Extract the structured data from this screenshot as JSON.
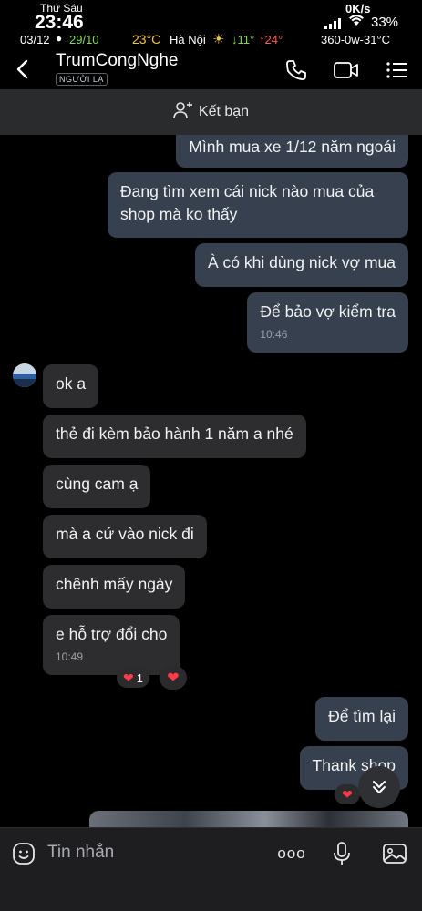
{
  "status_bar": {
    "day": "Thứ Sáu",
    "time": "23:46",
    "date": "03/12",
    "lunar_date": "29/10",
    "temperature": "23°C",
    "city": "Hà Nội",
    "temp_low": "↓11°",
    "temp_high": "↑24°",
    "aqi": "360-0w-31°C",
    "net_speed": "0K/s",
    "battery": "33%"
  },
  "header": {
    "contact_name": "TrumCongNghe",
    "badge": "NGƯỜI LẠ"
  },
  "friend_bar": {
    "label": "Kết bạn"
  },
  "messages": [
    {
      "direction": "out",
      "text": "Mình mua xe 1/12 năm ngoái"
    },
    {
      "direction": "out",
      "text": "Đang tìm xem cái nick nào mua của shop mà ko thấy"
    },
    {
      "direction": "out",
      "text": "À có khi dùng nick vợ mua"
    },
    {
      "direction": "out",
      "text": "Để bảo vợ kiểm tra",
      "time": "10:46"
    },
    {
      "direction": "in",
      "text": "ok a"
    },
    {
      "direction": "in",
      "text": "thẻ đi kèm bảo hành 1 năm a nhé"
    },
    {
      "direction": "in",
      "text": "cùng cam ạ"
    },
    {
      "direction": "in",
      "text": "mà a cứ vào nick đi"
    },
    {
      "direction": "in",
      "text": "chênh mấy ngày"
    },
    {
      "direction": "in",
      "text": "e hỗ trợ đổi cho",
      "time": "10:49"
    },
    {
      "direction": "out",
      "text": "Để tìm lại"
    },
    {
      "direction": "out",
      "text": "Thank shop"
    }
  ],
  "reactions": {
    "heart_count": "1"
  },
  "input_bar": {
    "placeholder": "Tin nhắn",
    "more_label": "ooo"
  },
  "colors": {
    "outgoing_bubble": "#36404f",
    "incoming_bubble": "#2d2d2f",
    "heart": "#ff3b4a"
  }
}
